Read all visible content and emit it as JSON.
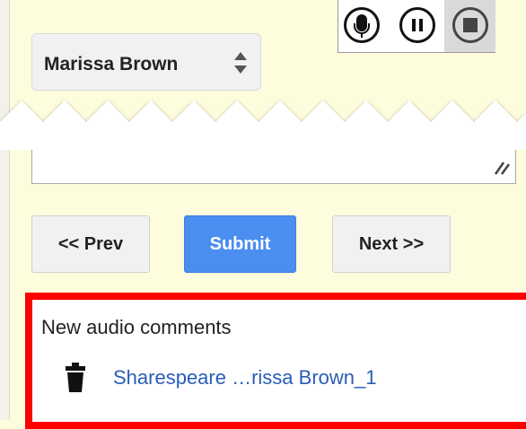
{
  "recorder": {
    "buttons": [
      {
        "name": "microphone",
        "icon": "microphone-icon"
      },
      {
        "name": "pause",
        "icon": "pause-icon"
      },
      {
        "name": "stop",
        "icon": "stop-icon"
      }
    ]
  },
  "user_select": {
    "selected": "Marissa Brown",
    "icon": "updown-arrows-icon"
  },
  "navigation": {
    "prev_label": "<< Prev",
    "submit_label": "Submit",
    "next_label": "Next >>"
  },
  "comments_panel": {
    "heading": "New audio comments",
    "items": [
      {
        "label": "Sharespeare …rissa Brown_1",
        "icon": "trash-icon"
      }
    ]
  },
  "colors": {
    "page_background": "#fdfcdc",
    "submit_blue": "#4a8ef0",
    "highlight_red": "#ff0000",
    "link_blue": "#2a5db8"
  }
}
